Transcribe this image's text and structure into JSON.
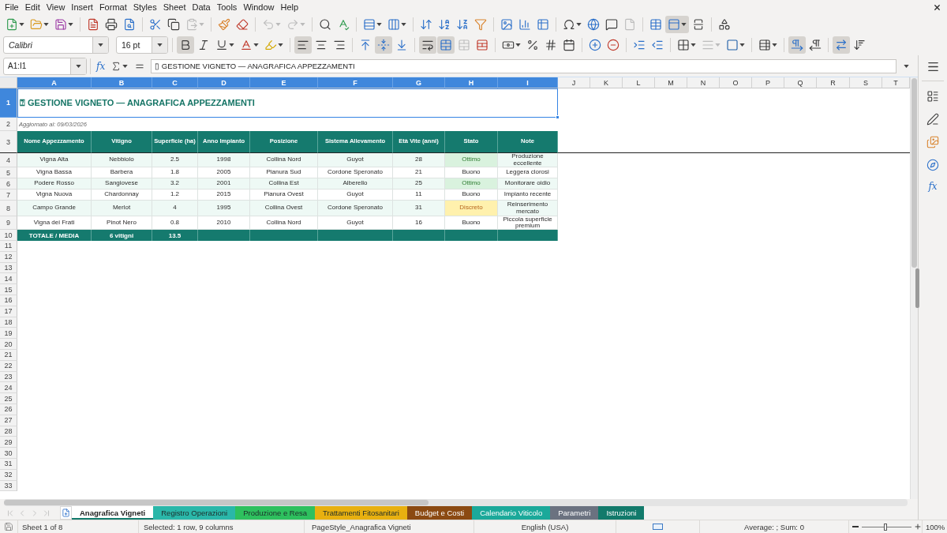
{
  "menu": [
    "File",
    "Edit",
    "View",
    "Insert",
    "Format",
    "Styles",
    "Sheet",
    "Data",
    "Tools",
    "Window",
    "Help"
  ],
  "toolbar_standard": [
    [
      {
        "kind": "new",
        "active": false,
        "disabled": false
      },
      {
        "kind": "open",
        "active": false,
        "disabled": false
      },
      {
        "kind": "save",
        "active": false,
        "disabled": false
      }
    ],
    [
      {
        "kind": "pdf",
        "active": false,
        "disabled": false
      },
      {
        "kind": "print",
        "active": false,
        "disabled": false
      },
      {
        "kind": "preview",
        "active": false,
        "disabled": false
      }
    ],
    [
      {
        "kind": "cut",
        "active": false,
        "disabled": false
      },
      {
        "kind": "copy",
        "active": false,
        "disabled": false
      },
      {
        "kind": "paste",
        "active": false,
        "disabled": true
      }
    ],
    [
      {
        "kind": "clone",
        "active": false,
        "disabled": false
      },
      {
        "kind": "clear",
        "active": false,
        "disabled": false
      }
    ],
    [
      {
        "kind": "undo",
        "active": false,
        "disabled": true
      },
      {
        "kind": "redo",
        "active": false,
        "disabled": true
      }
    ],
    [
      {
        "kind": "find",
        "active": false,
        "disabled": false
      },
      {
        "kind": "spelling",
        "active": false,
        "disabled": false
      }
    ],
    [
      {
        "kind": "rows",
        "active": false,
        "disabled": false
      },
      {
        "kind": "columns",
        "active": false,
        "disabled": false
      }
    ],
    [
      {
        "kind": "sort",
        "active": false,
        "disabled": false
      },
      {
        "kind": "sort_asc",
        "active": false,
        "disabled": false
      },
      {
        "kind": "sort_desc",
        "active": false,
        "disabled": false
      },
      {
        "kind": "filter",
        "active": false,
        "disabled": false
      }
    ],
    [
      {
        "kind": "image",
        "active": false,
        "disabled": false
      },
      {
        "kind": "chart",
        "active": false,
        "disabled": false
      },
      {
        "kind": "pivot",
        "active": false,
        "disabled": false
      }
    ],
    [
      {
        "kind": "special_char",
        "active": false,
        "disabled": false
      },
      {
        "kind": "hyperlink",
        "active": false,
        "disabled": false
      },
      {
        "kind": "comment",
        "active": false,
        "disabled": false
      },
      {
        "kind": "header_footer",
        "active": false,
        "disabled": true
      }
    ],
    [
      {
        "kind": "print_area",
        "active": false,
        "disabled": false
      },
      {
        "kind": "freeze",
        "active": true,
        "disabled": false
      },
      {
        "kind": "split",
        "active": false,
        "disabled": false
      }
    ],
    [
      {
        "kind": "shapes",
        "active": false,
        "disabled": false
      }
    ]
  ],
  "toolbar_formatting": {
    "font_name": "Calibri",
    "font_size": "16 pt",
    "groups": [
      [
        {
          "kind": "bold",
          "active": true,
          "disabled": false
        },
        {
          "kind": "italic",
          "active": false,
          "disabled": false
        },
        {
          "kind": "underline",
          "active": false,
          "disabled": false
        },
        {
          "kind": "font_color",
          "active": false,
          "disabled": false
        },
        {
          "kind": "highlight",
          "active": false,
          "disabled": false
        }
      ],
      [
        {
          "kind": "align_left",
          "active": true,
          "disabled": false
        },
        {
          "kind": "align_center",
          "active": false,
          "disabled": false
        },
        {
          "kind": "align_right",
          "active": false,
          "disabled": false
        }
      ],
      [
        {
          "kind": "align_top",
          "active": false,
          "disabled": false
        },
        {
          "kind": "align_middle",
          "active": true,
          "disabled": false
        },
        {
          "kind": "align_bottom",
          "active": false,
          "disabled": false
        }
      ],
      [
        {
          "kind": "wrap",
          "active": true,
          "disabled": false
        },
        {
          "kind": "merge_center",
          "active": true,
          "disabled": false
        },
        {
          "kind": "merge",
          "active": false,
          "disabled": true
        },
        {
          "kind": "unmerge",
          "active": false,
          "disabled": false
        }
      ],
      [
        {
          "kind": "currency",
          "active": false,
          "disabled": false
        },
        {
          "kind": "percent",
          "active": false,
          "disabled": false
        },
        {
          "kind": "number",
          "active": false,
          "disabled": false
        },
        {
          "kind": "date",
          "active": false,
          "disabled": false
        }
      ],
      [
        {
          "kind": "add_decimal",
          "active": false,
          "disabled": false
        },
        {
          "kind": "delete_decimal",
          "active": false,
          "disabled": false
        }
      ],
      [
        {
          "kind": "indent_increase",
          "active": false,
          "disabled": false
        },
        {
          "kind": "indent_decrease",
          "active": false,
          "disabled": false
        }
      ],
      [
        {
          "kind": "borders",
          "active": false,
          "disabled": false
        },
        {
          "kind": "border_style",
          "active": false,
          "disabled": true
        },
        {
          "kind": "border_color",
          "active": false,
          "disabled": false
        }
      ],
      [
        {
          "kind": "conditional",
          "active": false,
          "disabled": false
        }
      ],
      [
        {
          "kind": "ltr",
          "active": true,
          "disabled": false
        },
        {
          "kind": "rtl",
          "active": false,
          "disabled": false
        }
      ],
      [
        {
          "kind": "text_direction",
          "active": true,
          "disabled": false
        },
        {
          "kind": "stacked",
          "active": false,
          "disabled": false
        }
      ]
    ]
  },
  "formula_bar": {
    "name_box": "A1:I1",
    "function_symbol": "fx",
    "content": "▯ GESTIONE VIGNETO — ANAGRAFICA APPEZZAMENTI"
  },
  "sidebar": {
    "function_symbol": "fx"
  },
  "sheet": {
    "columns": [
      {
        "label": "A",
        "selected": true
      },
      {
        "label": "B",
        "selected": true
      },
      {
        "label": "C",
        "selected": true
      },
      {
        "label": "D",
        "selected": true
      },
      {
        "label": "E",
        "selected": true
      },
      {
        "label": "F",
        "selected": true
      },
      {
        "label": "G",
        "selected": true
      },
      {
        "label": "H",
        "selected": true
      },
      {
        "label": "I",
        "selected": true
      },
      {
        "label": "J",
        "selected": false
      },
      {
        "label": "K",
        "selected": false
      },
      {
        "label": "L",
        "selected": false
      },
      {
        "label": "M",
        "selected": false
      },
      {
        "label": "N",
        "selected": false
      },
      {
        "label": "O",
        "selected": false
      },
      {
        "label": "P",
        "selected": false
      },
      {
        "label": "Q",
        "selected": false
      },
      {
        "label": "R",
        "selected": false
      },
      {
        "label": "S",
        "selected": false
      },
      {
        "label": "T",
        "selected": false
      }
    ],
    "rows": [
      {
        "label": "1",
        "selected": true
      },
      {
        "label": "2",
        "selected": false
      },
      {
        "label": "3",
        "selected": false
      },
      {
        "label": "4",
        "selected": false
      },
      {
        "label": "5",
        "selected": false
      },
      {
        "label": "6",
        "selected": false
      },
      {
        "label": "7",
        "selected": false
      },
      {
        "label": "8",
        "selected": false
      },
      {
        "label": "9",
        "selected": false
      },
      {
        "label": "10",
        "selected": false
      },
      {
        "label": "11",
        "selected": false
      },
      {
        "label": "12",
        "selected": false
      },
      {
        "label": "13",
        "selected": false
      },
      {
        "label": "14",
        "selected": false
      },
      {
        "label": "15",
        "selected": false
      },
      {
        "label": "16",
        "selected": false
      },
      {
        "label": "17",
        "selected": false
      },
      {
        "label": "18",
        "selected": false
      },
      {
        "label": "19",
        "selected": false
      },
      {
        "label": "20",
        "selected": false
      },
      {
        "label": "21",
        "selected": false
      },
      {
        "label": "22",
        "selected": false
      },
      {
        "label": "23",
        "selected": false
      },
      {
        "label": "24",
        "selected": false
      },
      {
        "label": "25",
        "selected": false
      },
      {
        "label": "26",
        "selected": false
      },
      {
        "label": "27",
        "selected": false
      },
      {
        "label": "28",
        "selected": false
      },
      {
        "label": "29",
        "selected": false
      },
      {
        "label": "30",
        "selected": false
      },
      {
        "label": "31",
        "selected": false
      },
      {
        "label": "32",
        "selected": false
      },
      {
        "label": "33",
        "selected": false
      }
    ],
    "title": "⍰ GESTIONE VIGNETO — ANAGRAFICA APPEZZAMENTI",
    "updated": "Aggiornato al: 09/03/2026",
    "table": {
      "headers": [
        "Nome Appezzamento",
        "Vitigno",
        "Superficie (ha)",
        "Anno Impianto",
        "Posizione",
        "Sistema Allevamento",
        "Età Vite (anni)",
        "Stato",
        "Note"
      ],
      "rows": [
        {
          "name": "Vigna Alta",
          "variety": "Nebbiolo",
          "area": "2.5",
          "planted": "1998",
          "position": "Collina Nord",
          "training": "Guyot",
          "age": "28",
          "status": {
            "label": "Ottimo",
            "kind": "good"
          },
          "note": "Produzione eccellente"
        },
        {
          "name": "Vigna Bassa",
          "variety": "Barbera",
          "area": "1.8",
          "planted": "2005",
          "position": "Pianura Sud",
          "training": "Cordone Speronato",
          "age": "21",
          "status": {
            "label": "Buono",
            "kind": "neutral"
          },
          "note": "Leggera clorosi"
        },
        {
          "name": "Podere Rosso",
          "variety": "Sangiovese",
          "area": "3.2",
          "planted": "2001",
          "position": "Collina Est",
          "training": "Alberello",
          "age": "25",
          "status": {
            "label": "Ottimo",
            "kind": "good"
          },
          "note": "Monitorare oidio"
        },
        {
          "name": "Vigna Nuova",
          "variety": "Chardonnay",
          "area": "1.2",
          "planted": "2015",
          "position": "Pianura Ovest",
          "training": "Guyot",
          "age": "11",
          "status": {
            "label": "Buono",
            "kind": "neutral"
          },
          "note": "Impianto recente"
        },
        {
          "name": "Campo Grande",
          "variety": "Merlot",
          "area": "4",
          "planted": "1995",
          "position": "Collina Ovest",
          "training": "Cordone Speronato",
          "age": "31",
          "status": {
            "label": "Discreto",
            "kind": "fair"
          },
          "note": "Reinserimento mercato"
        },
        {
          "name": "Vigna dei Frati",
          "variety": "Pinot Nero",
          "area": "0.8",
          "planted": "2010",
          "position": "Collina Nord",
          "training": "Guyot",
          "age": "16",
          "status": {
            "label": "Buono",
            "kind": "neutral"
          },
          "note": "Piccola superficie premium"
        }
      ],
      "total": {
        "label": "TOTALE / MEDIA",
        "varieties": "6 vitigni",
        "area": "13.5"
      }
    }
  },
  "sheet_nav": [
    {
      "kind": "first",
      "disabled": true
    },
    {
      "kind": "previous",
      "disabled": true
    },
    {
      "kind": "next",
      "disabled": true
    },
    {
      "kind": "last",
      "disabled": true
    }
  ],
  "sheet_tabs": [
    {
      "label": "Anagrafica Vigneti",
      "selected": true,
      "color": "#127a6b"
    },
    {
      "label": "Registro Operazioni",
      "selected": false,
      "color": "#2ab7a9"
    },
    {
      "label": "Produzione e Resa",
      "selected": false,
      "color": "#2ec05e"
    },
    {
      "label": "Trattamenti Fitosanitari",
      "selected": false,
      "color": "#e8b010"
    },
    {
      "label": "Budget e Costi",
      "selected": false,
      "color": "#8b4a12"
    },
    {
      "label": "Calendario Viticolo",
      "selected": false,
      "color": "#1ba99a"
    },
    {
      "label": "Parametri",
      "selected": false,
      "color": "#6b7280"
    },
    {
      "label": "Istruzioni",
      "selected": false,
      "color": "#127a6b"
    }
  ],
  "status_bar": {
    "sheet": "Sheet 1 of 8",
    "selection": "Selected: 1 row, 9 columns",
    "page_style": "PageStyle_Anagrafica Vigneti",
    "language": "English (USA)",
    "sum": "Average: ; Sum: 0",
    "zoom": {
      "level": 0.48,
      "reading": "100%"
    }
  }
}
